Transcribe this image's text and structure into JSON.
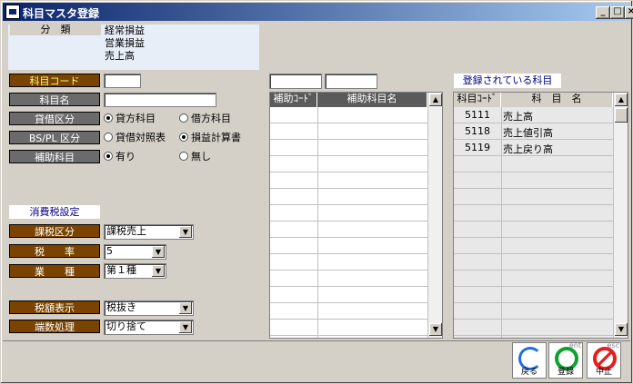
{
  "window": {
    "title": "科目マスタ登録",
    "min": "_",
    "max": "□",
    "close": "×"
  },
  "category": {
    "label": "分　類",
    "lines": [
      "経常損益",
      "営業損益",
      "売上高"
    ]
  },
  "form": {
    "code_label": "科目コード",
    "name_label": "科目名",
    "debit_credit_label": "貸借区分",
    "debit_credit": {
      "opt1": "貸方科目",
      "opt2": "借方科目",
      "selected": "貸方科目"
    },
    "bspl_label": "BS/PL 区分",
    "bspl": {
      "opt1": "貸借対照表",
      "opt2": "損益計算書",
      "selected": "損益計算書"
    },
    "sub_label": "補助科目",
    "sub": {
      "opt1": "有り",
      "opt2": "無し",
      "selected": "有り"
    },
    "tax_section": "消費税設定",
    "tax_type_label": "課税区分",
    "tax_type": "課税売上",
    "rate_label": "税　　率",
    "rate": "5",
    "industry_label": "業　　種",
    "industry": "第１種",
    "display_label": "税額表示",
    "display": "税抜き",
    "rounding_label": "端数処理",
    "rounding": "切り捨て"
  },
  "sub_grid": {
    "headers": [
      "補助ｺｰﾄﾞ",
      "補助科目名"
    ]
  },
  "registered": {
    "title": "登録されている科目",
    "headers": [
      "科目ｺｰﾄﾞ",
      "科　目　名"
    ],
    "rows": [
      {
        "code": "5111",
        "name": "売上高"
      },
      {
        "code": "5118",
        "name": "売上値引高"
      },
      {
        "code": "5119",
        "name": "売上戻り高"
      }
    ]
  },
  "buttons": {
    "back": "戻る",
    "save": "登録",
    "cancel": "中止",
    "save_hint": "ent",
    "cancel_hint": "esc"
  }
}
